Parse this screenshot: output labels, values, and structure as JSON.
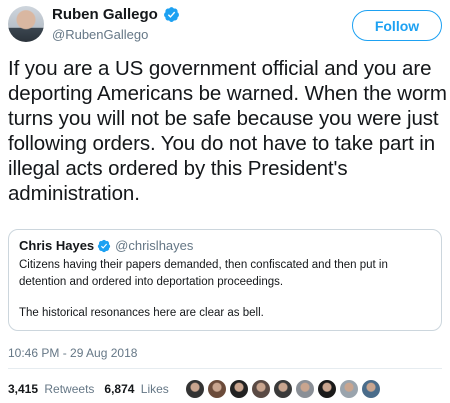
{
  "user": {
    "display_name": "Ruben Gallego",
    "handle": "@RubenGallego",
    "avatar_icon": "profile-photo"
  },
  "follow_label": "Follow",
  "tweet": {
    "text": "If you are a US government official and you are deporting Americans be warned. When the worm turns you will not be safe because you were just following orders. You do not have to take part in illegal acts ordered by this President's administration."
  },
  "quote": {
    "name": "Chris Hayes",
    "handle": "@chrislhayes",
    "text1": "Citizens having their papers demanded, then confiscated and then put in detention and ordered into deportation proceedings.",
    "text2": "The historical resonances here are clear as bell."
  },
  "timestamp": "10:46 PM - 29 Aug 2018",
  "stats": {
    "retweets_count": "3,415",
    "retweets_label": "Retweets",
    "likes_count": "6,874",
    "likes_label": "Likes"
  },
  "colors": {
    "accent": "#1da1f2",
    "muted": "#657786",
    "text": "#14171a",
    "border": "#ccd6dd"
  },
  "likers": [
    "#333333",
    "#6b4b3a",
    "#222222",
    "#5a4a44",
    "#3a3a3a",
    "#8a8f96",
    "#1a1a1a",
    "#9aa4ad",
    "#4a6c8a"
  ]
}
